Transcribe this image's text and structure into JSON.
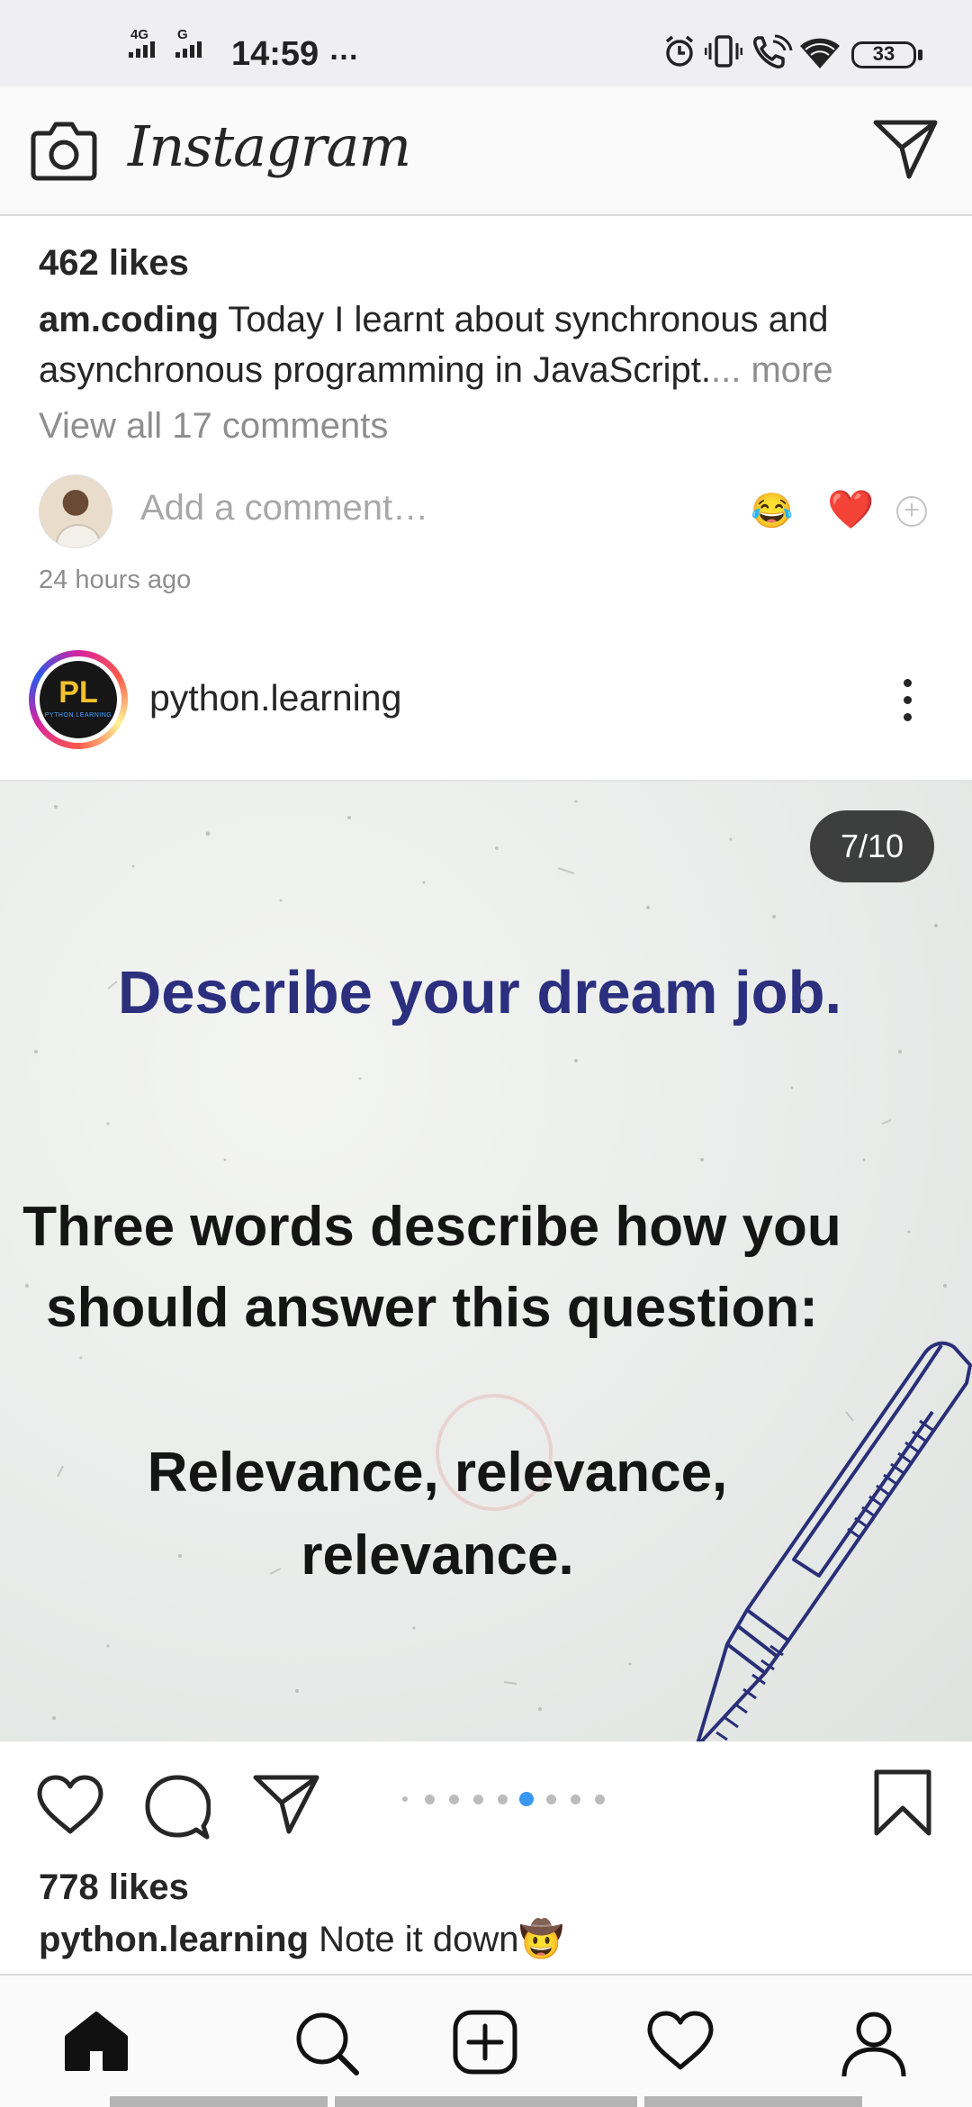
{
  "status_bar": {
    "net1": "4G",
    "net2": "G",
    "time": "14:59",
    "more": "…",
    "battery": "33",
    "icons": [
      "alarm-icon",
      "vibrate-icon",
      "wifi-call-icon",
      "wifi-icon",
      "battery-icon"
    ]
  },
  "header": {
    "logo": "Instagram",
    "icons": [
      "camera-icon",
      "direct-message-icon"
    ]
  },
  "previous_post": {
    "likes": "462 likes",
    "caption_user": "am.coding",
    "caption_text": " Today I learnt about synchronous and asynchronous programming in JavaScript.",
    "caption_more": "... more",
    "view_comments": "View all 17 comments",
    "comment_placeholder": "Add a comment…",
    "quick_reactions": [
      "😂",
      "❤️"
    ],
    "timestamp": "24 hours ago"
  },
  "post": {
    "username": "python.learning",
    "avatar_text": "PL",
    "avatar_subtext": "PYTHON.LEARNING",
    "counter": "7/10",
    "image_title": "Describe your dream job.",
    "image_line1": "Three words describe how you",
    "image_line2": "should answer this question:",
    "image_answer1": "Relevance, relevance,",
    "image_answer2": "relevance.",
    "carousel": {
      "total": 10,
      "active": 7
    },
    "likes": "778 likes",
    "caption_user": "python.learning",
    "caption_text": " Note it down🤠"
  },
  "bottom_nav": [
    "home-icon",
    "search-icon",
    "new-post-icon",
    "activity-icon",
    "profile-icon"
  ],
  "colors": {
    "text": "#262626",
    "muted": "#8e8e8e",
    "image_title": "#2b2f7e",
    "heart": "#e0162b",
    "carousel_active": "#3897f0"
  }
}
